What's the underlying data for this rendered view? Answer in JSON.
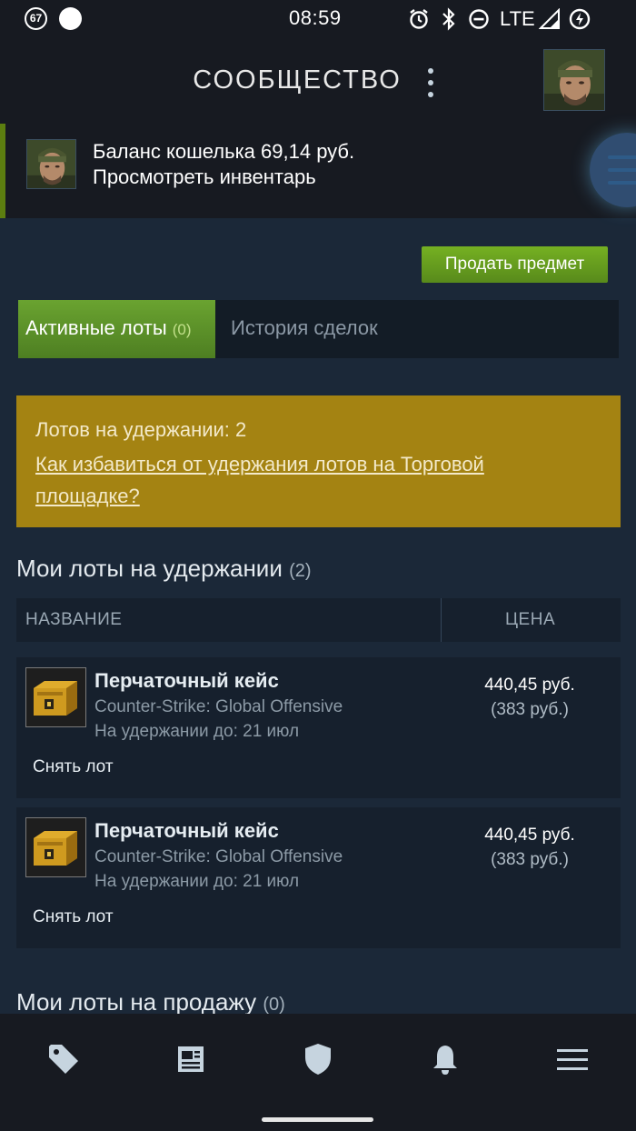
{
  "status_bar": {
    "notification_badge": "67",
    "time": "08:59",
    "network": "LTE"
  },
  "header": {
    "title": "СООБЩЕСТВО"
  },
  "wallet": {
    "balance_text": "Баланс кошелька 69,14 руб.",
    "inventory_link": "Просмотреть инвентарь"
  },
  "actions": {
    "sell_button": "Продать предмет"
  },
  "tabs": {
    "active_label": "Активные лоты",
    "active_count": "(0)",
    "history_label": "История сделок"
  },
  "hold_notice": {
    "count_text": "Лотов на удержании: 2",
    "help_link": "Как избавиться от удержания лотов на Торговой площадке?"
  },
  "on_hold_section": {
    "title": "Мои лоты на удержании",
    "count": "(2)",
    "columns": {
      "name": "НАЗВАНИЕ",
      "price": "ЦЕНА"
    },
    "listings": [
      {
        "name": "Перчаточный кейс",
        "game": "Counter-Strike: Global Offensive",
        "hold_until": "На удержании до: 21 июл",
        "price": "440,45 руб.",
        "price_sub": "(383 руб.)",
        "remove_label": "Снять лот"
      },
      {
        "name": "Перчаточный кейс",
        "game": "Counter-Strike: Global Offensive",
        "hold_until": "На удержании до: 21 июл",
        "price": "440,45 руб.",
        "price_sub": "(383 руб.)",
        "remove_label": "Снять лот"
      }
    ]
  },
  "for_sale_section": {
    "title": "Мои лоты на продажу",
    "count": "(0)"
  },
  "bottom_nav": [
    {
      "icon": "tag-icon"
    },
    {
      "icon": "news-icon"
    },
    {
      "icon": "shield-icon"
    },
    {
      "icon": "bell-icon"
    },
    {
      "icon": "menu-icon"
    }
  ],
  "colors": {
    "background": "#1b2838",
    "header": "#171a21",
    "accent_green": "#5c7e10",
    "hold_notice": "#a48312"
  }
}
